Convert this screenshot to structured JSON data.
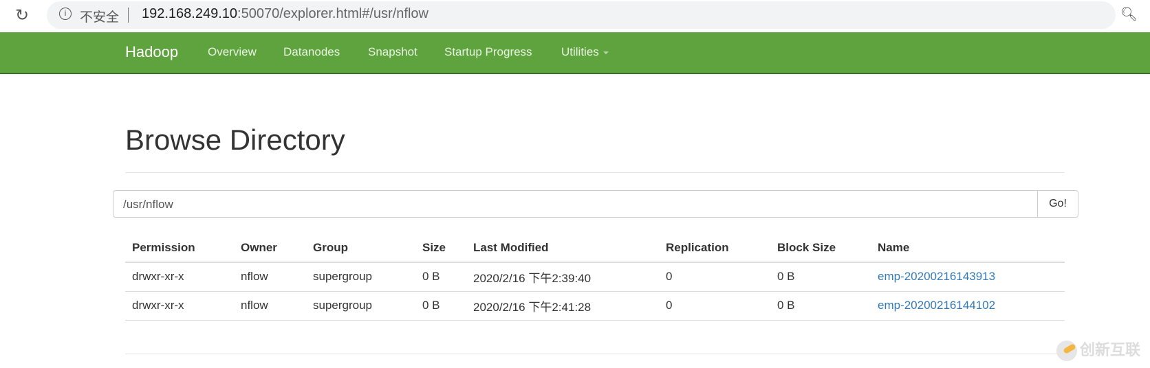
{
  "browser": {
    "security_label": "不安全",
    "url_host": "192.168.249.10",
    "url_rest": ":50070/explorer.html#/usr/nflow"
  },
  "nav": {
    "brand": "Hadoop",
    "items": [
      "Overview",
      "Datanodes",
      "Snapshot",
      "Startup Progress",
      "Utilities"
    ]
  },
  "page": {
    "title": "Browse Directory",
    "path_value": "/usr/nflow",
    "go_label": "Go!"
  },
  "table": {
    "headers": [
      "Permission",
      "Owner",
      "Group",
      "Size",
      "Last Modified",
      "Replication",
      "Block Size",
      "Name"
    ],
    "rows": [
      [
        "drwxr-xr-x",
        "nflow",
        "supergroup",
        "0 B",
        "2020/2/16 下午2:39:40",
        "0",
        "0 B",
        "emp-20200216143913"
      ],
      [
        "drwxr-xr-x",
        "nflow",
        "supergroup",
        "0 B",
        "2020/2/16 下午2:41:28",
        "0",
        "0 B",
        "emp-20200216144102"
      ]
    ]
  },
  "watermark": "创新互联"
}
